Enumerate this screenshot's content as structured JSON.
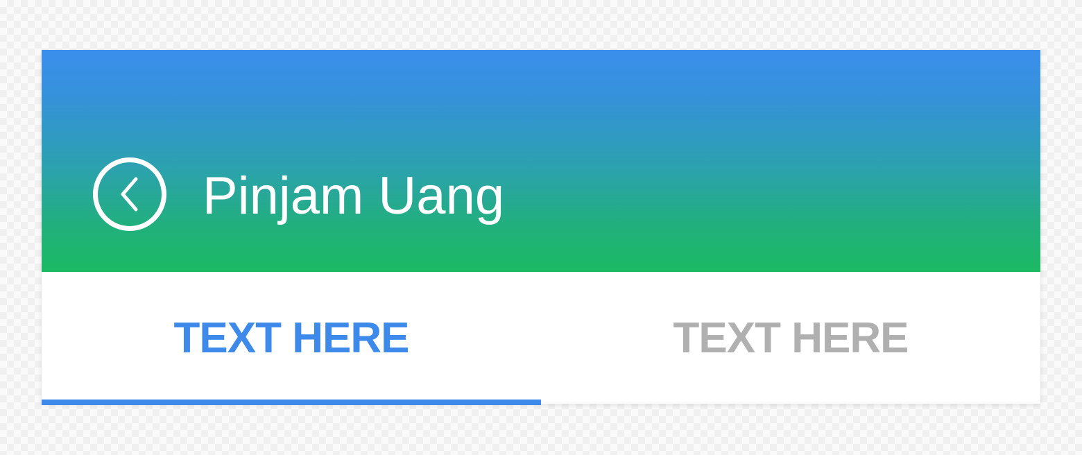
{
  "app_bar": {
    "title": "Pinjam Uang",
    "back_icon": "chevron-left-circle-icon",
    "gradient_top": "#3b8fec",
    "gradient_bottom": "#1bba62",
    "text_color": "#ffffff"
  },
  "tabs": [
    {
      "label": "TEXT HERE",
      "selected": true,
      "color": "#3d8aeb"
    },
    {
      "label": "TEXT HERE",
      "selected": false,
      "color": "#b0b0b0"
    }
  ],
  "tab_indicator": {
    "color": "#3d8aeb",
    "selected_index": 0
  }
}
